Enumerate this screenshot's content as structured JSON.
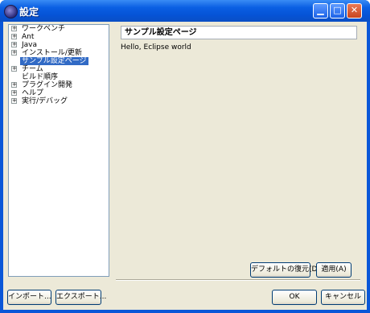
{
  "window": {
    "title": "設定"
  },
  "tree": {
    "items": [
      {
        "label": "ワークベンチ",
        "expander": "+",
        "selected": false
      },
      {
        "label": "Ant",
        "expander": "+",
        "selected": false
      },
      {
        "label": "Java",
        "expander": "+",
        "selected": false
      },
      {
        "label": "インストール/更新",
        "expander": "+",
        "selected": false
      },
      {
        "label": "サンプル設定ページ",
        "expander": "",
        "selected": true
      },
      {
        "label": "チーム",
        "expander": "+",
        "selected": false
      },
      {
        "label": "ビルド順序",
        "expander": "",
        "selected": false
      },
      {
        "label": "プラグイン開発",
        "expander": "+",
        "selected": false
      },
      {
        "label": "ヘルプ",
        "expander": "+",
        "selected": false
      },
      {
        "label": "実行/デバッグ",
        "expander": "+",
        "selected": false
      }
    ]
  },
  "page": {
    "title": "サンプル設定ページ",
    "body": "Hello, Eclipse world",
    "restore_defaults": "デフォルトの復元(D)",
    "apply": "適用(A)"
  },
  "footer": {
    "import": "インポート...",
    "export": "エクスポート...",
    "ok": "OK",
    "cancel": "キャンセル"
  },
  "colors": {
    "selection": "#316ac5",
    "titlebar": "#0553d6",
    "dialog_bg": "#ece9d8"
  }
}
